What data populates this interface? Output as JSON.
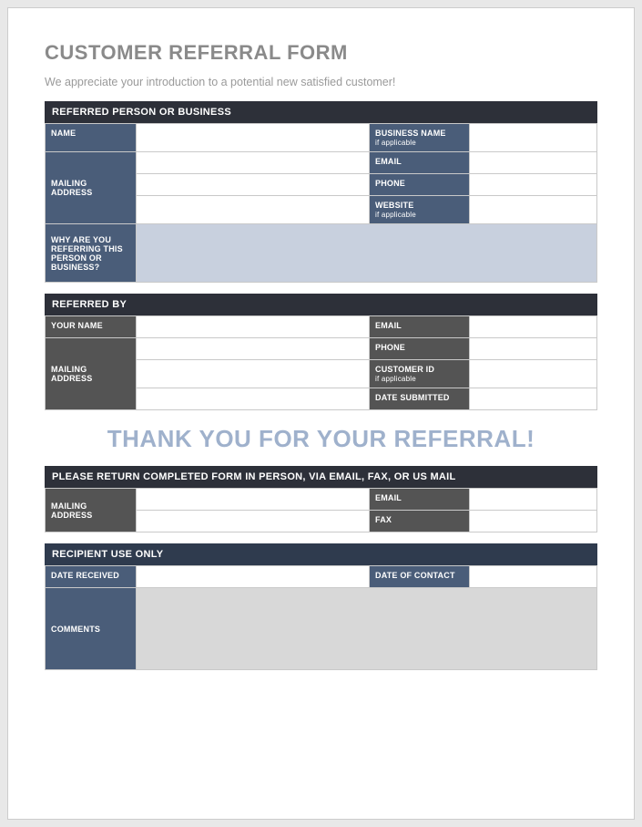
{
  "title": "CUSTOMER REFERRAL FORM",
  "subtitle": "We appreciate your introduction to a potential new satisfied customer!",
  "section1": {
    "header": "REFERRED PERSON OR BUSINESS",
    "name": "NAME",
    "mailing": "MAILING ADDRESS",
    "business": "BUSINESS NAME",
    "business_sub": "if applicable",
    "email": "EMAIL",
    "phone": "PHONE",
    "website": "WEBSITE",
    "website_sub": "if applicable",
    "why": "WHY ARE YOU REFERRING THIS PERSON OR BUSINESS?"
  },
  "section2": {
    "header": "REFERRED BY",
    "yourname": "YOUR NAME",
    "mailing": "MAILING ADDRESS",
    "email": "EMAIL",
    "phone": "PHONE",
    "custid": "CUSTOMER ID",
    "custid_sub": "if applicable",
    "date": "DATE SUBMITTED"
  },
  "thanks": "THANK YOU FOR YOUR REFERRAL!",
  "section3": {
    "header": "PLEASE RETURN COMPLETED FORM IN PERSON, VIA EMAIL, FAX, OR US MAIL",
    "mailing": "MAILING ADDRESS",
    "email": "EMAIL",
    "fax": "FAX"
  },
  "section4": {
    "header": "RECIPIENT USE ONLY",
    "received": "DATE RECEIVED",
    "contact": "DATE OF CONTACT",
    "comments": "COMMENTS"
  }
}
